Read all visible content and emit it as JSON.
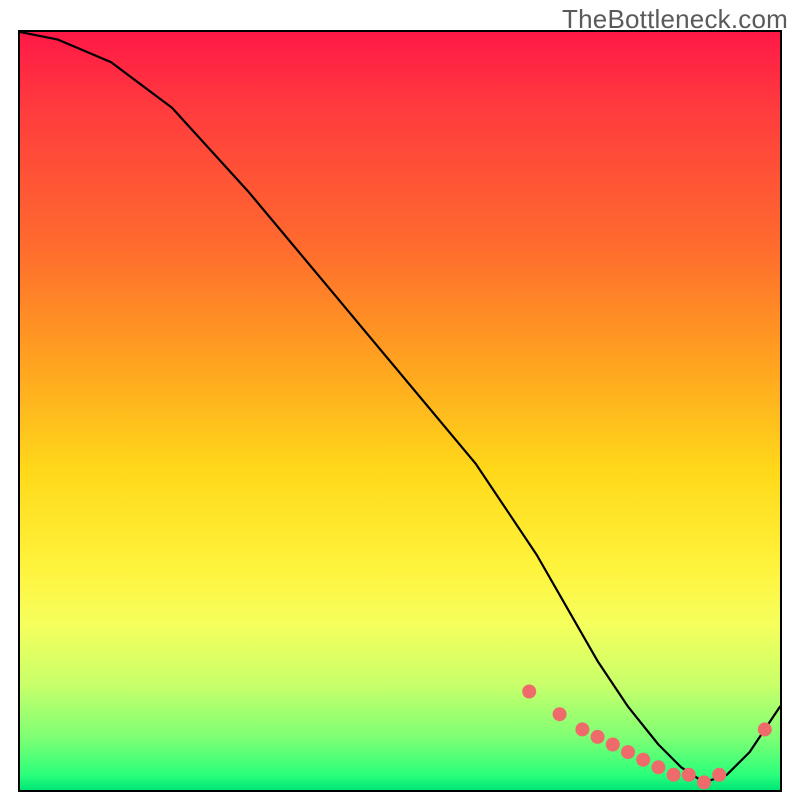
{
  "watermark": "TheBottleneck.com",
  "chart_data": {
    "type": "line",
    "title": "",
    "xlabel": "",
    "ylabel": "",
    "xlim": [
      0,
      100
    ],
    "ylim": [
      0,
      100
    ],
    "grid": false,
    "legend": false,
    "series": [
      {
        "name": "curve",
        "x": [
          0,
          5,
          12,
          20,
          30,
          40,
          50,
          60,
          68,
          72,
          76,
          80,
          84,
          87,
          90,
          93,
          96,
          100
        ],
        "y": [
          100,
          99,
          96,
          90,
          79,
          67,
          55,
          43,
          31,
          24,
          17,
          11,
          6,
          3,
          1,
          2,
          5,
          11
        ]
      }
    ],
    "markers": {
      "name": "highlight-dots",
      "x": [
        67,
        71,
        74,
        76,
        78,
        80,
        82,
        84,
        86,
        88,
        90,
        92,
        98
      ],
      "y": [
        13,
        10,
        8,
        7,
        6,
        5,
        4,
        3,
        2,
        2,
        1,
        2,
        8
      ]
    },
    "colors": {
      "line": "#000000",
      "marker": "#ef6b6b",
      "bg_top": "#ff1846",
      "bg_mid": "#fff23a",
      "bg_bottom": "#00e676"
    }
  }
}
